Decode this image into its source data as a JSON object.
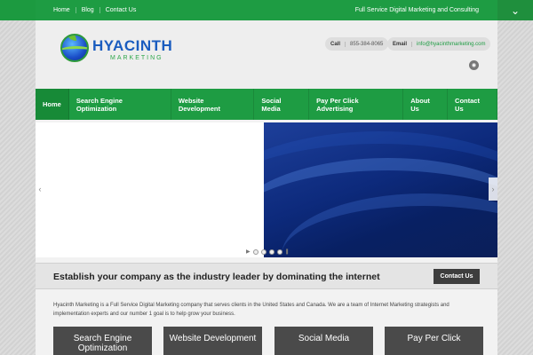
{
  "top_links": [
    "Home",
    "Blog",
    "Contact Us"
  ],
  "tagline": "Full Service Digital Marketing and Consulting",
  "logo": {
    "name": "HYACINTH",
    "sub": "MARKETING"
  },
  "contact": {
    "call_label": "Call",
    "call_value": "855-384-8065",
    "email_label": "Email",
    "email_value": "info@hyacinthmarketing.com"
  },
  "rss_icon": "rss-icon",
  "main_nav": [
    "Home",
    "Search Engine Optimization",
    "Website Development",
    "Social Media",
    "Pay Per Click Advertising",
    "About Us",
    "Contact Us"
  ],
  "banner": {
    "headline": "Establish your company as the industry leader by dominating the internet",
    "cta": "Contact Us"
  },
  "intro": "Hyacinth Marketing is a Full Service Digital Marketing company that serves clients in the United States and Canada. We are a team of Internet Marketing strategists and implementation experts and our number 1 goal is to help grow your business.",
  "services": [
    "Search Engine Optimization",
    "Website Development",
    "Social Media",
    "Pay Per Click"
  ],
  "colors": {
    "brand_green": "#1e9c43",
    "logo_blue": "#1a5cbf",
    "dark_button": "#3d3d3d"
  }
}
